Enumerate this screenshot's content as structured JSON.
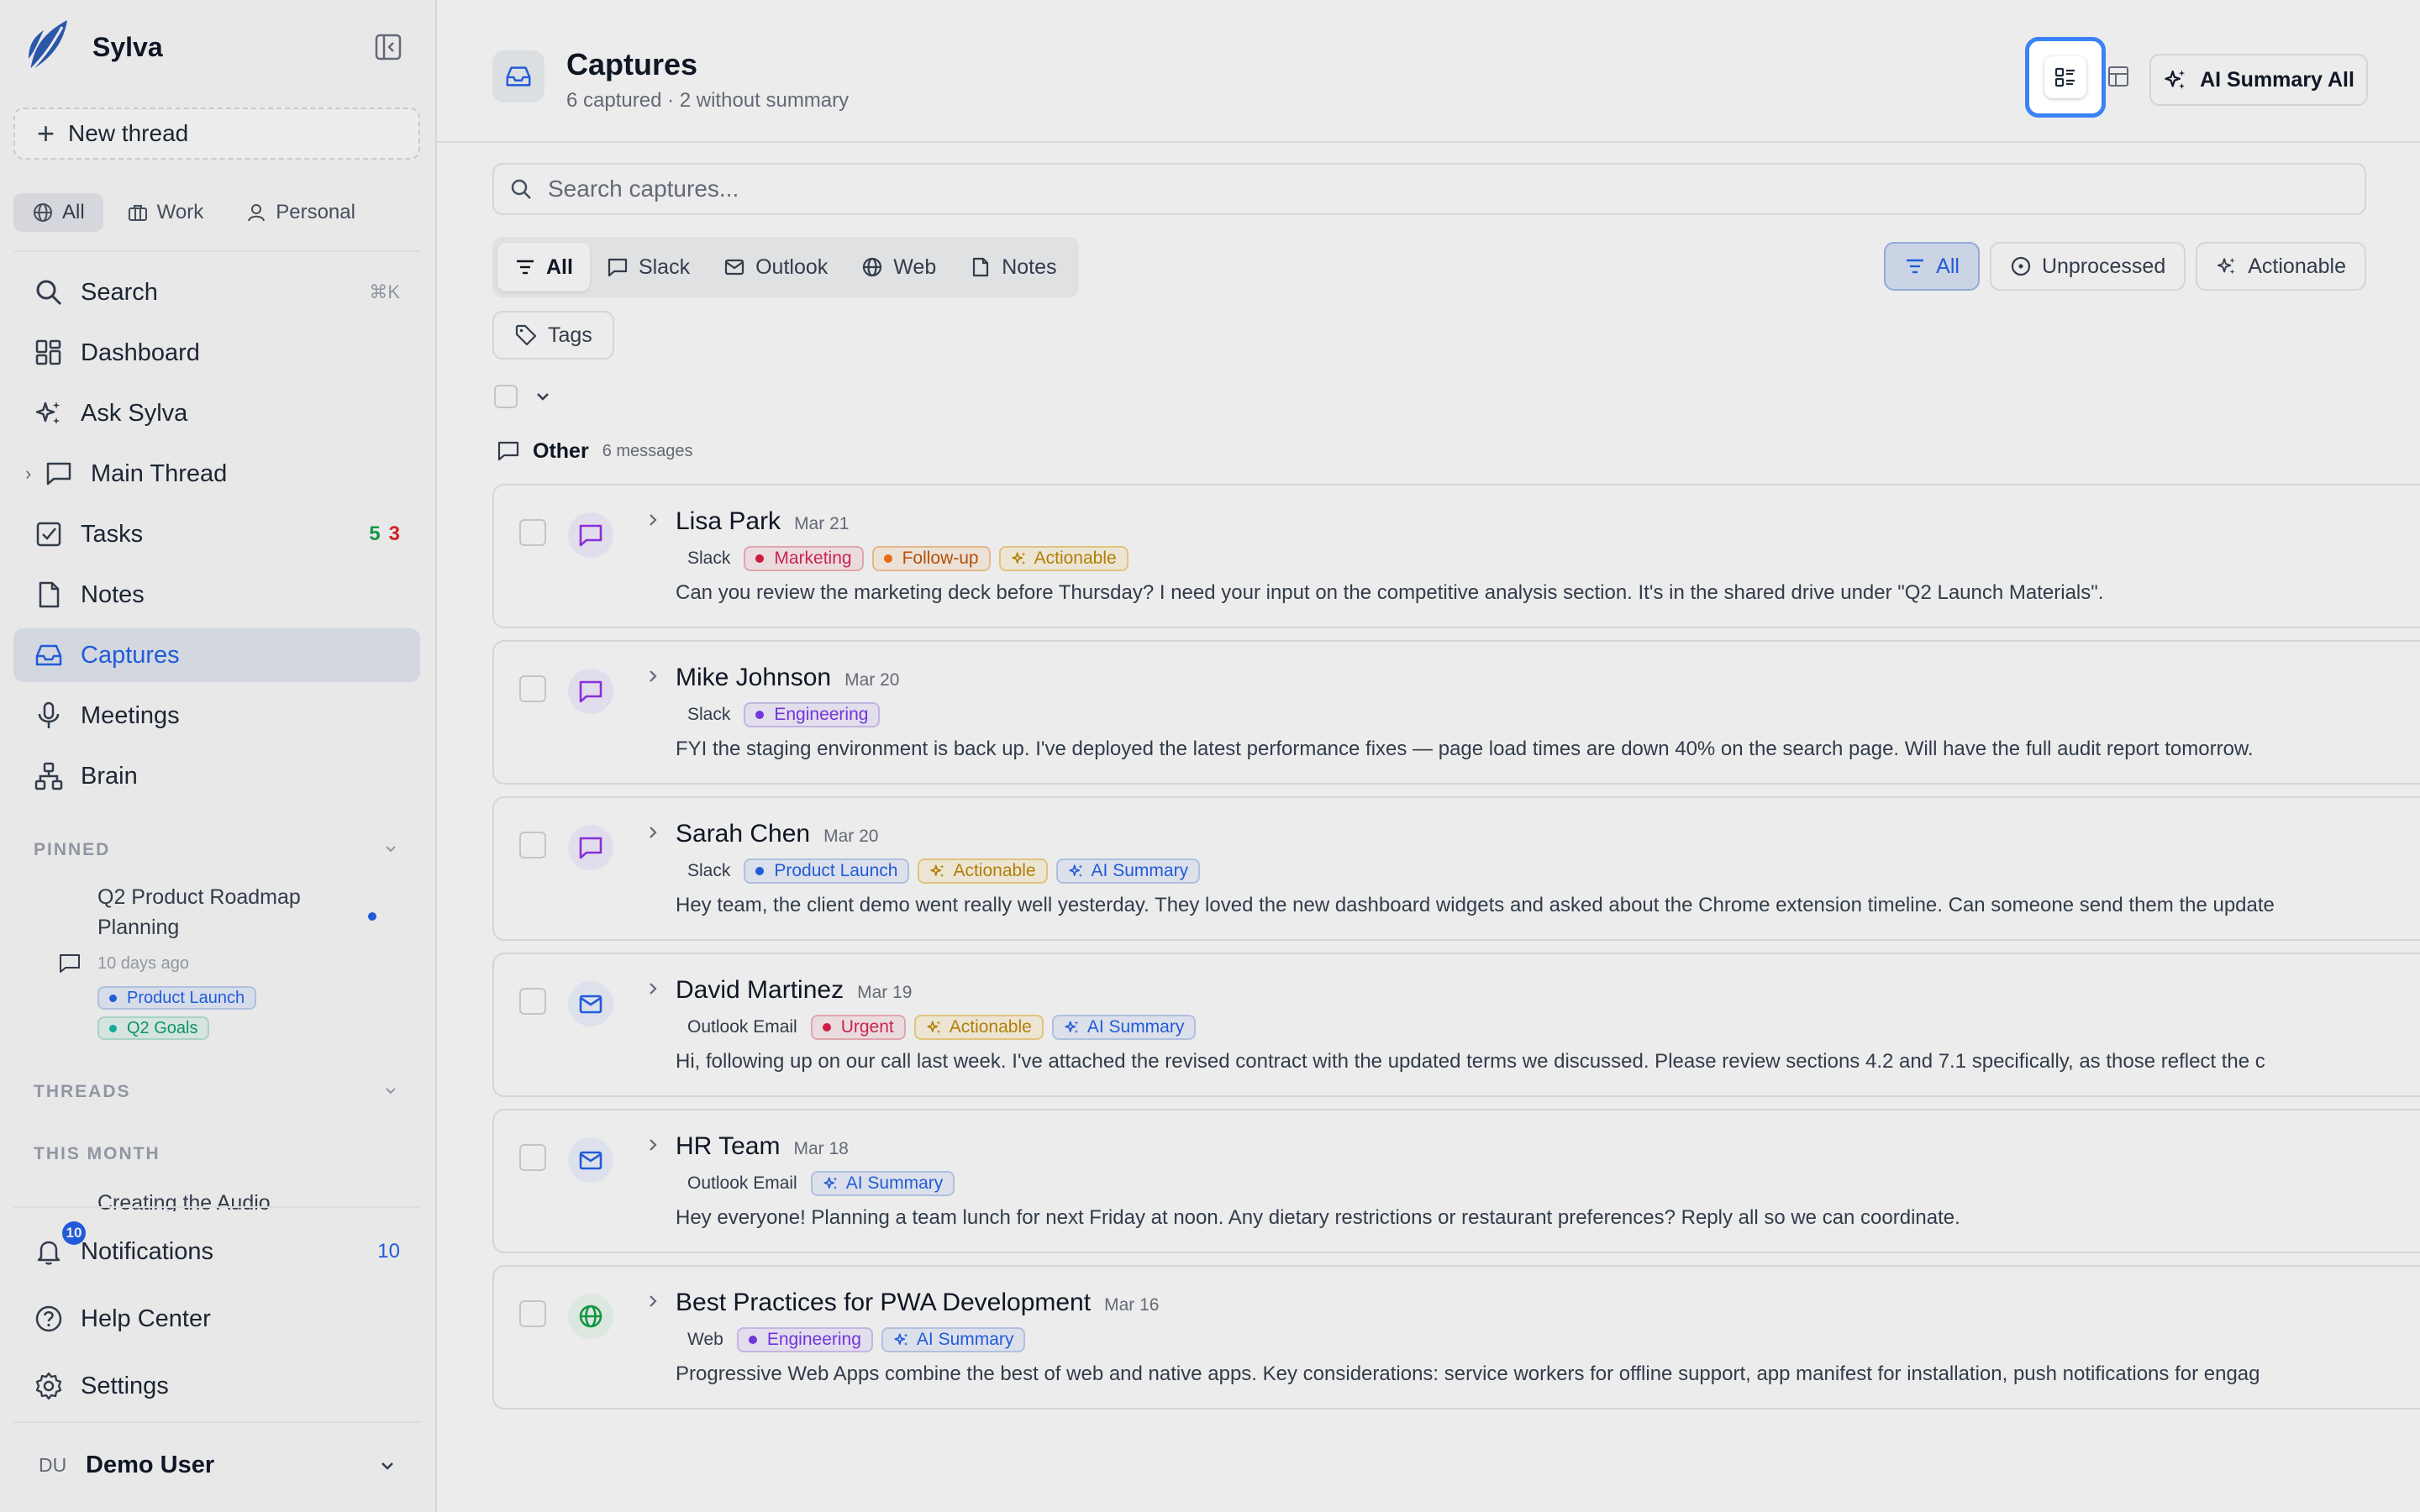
{
  "app": {
    "name": "Sylva"
  },
  "sidebar": {
    "new_thread": "New thread",
    "scope": [
      {
        "label": "All",
        "icon": "globe-icon"
      },
      {
        "label": "Work",
        "icon": "briefcase-icon"
      },
      {
        "label": "Personal",
        "icon": "user-icon"
      }
    ],
    "nav": [
      {
        "label": "Search",
        "icon": "search-icon",
        "shortcut": "⌘K"
      },
      {
        "label": "Dashboard",
        "icon": "dashboard-icon"
      },
      {
        "label": "Ask Sylva",
        "icon": "sparkles-icon"
      },
      {
        "label": "Main Thread",
        "icon": "chat-icon"
      },
      {
        "label": "Tasks",
        "icon": "checkbox-icon",
        "count_done": "5",
        "count_open": "3"
      },
      {
        "label": "Notes",
        "icon": "note-icon"
      },
      {
        "label": "Captures",
        "icon": "inbox-icon"
      },
      {
        "label": "Meetings",
        "icon": "microphone-icon"
      },
      {
        "label": "Brain",
        "icon": "network-icon"
      }
    ],
    "pinned": {
      "title": "PINNED",
      "item": {
        "title": "Q2 Product Roadmap Planning",
        "time": "10 days ago",
        "tags": [
          "Product Launch",
          "Q2 Goals"
        ]
      }
    },
    "threads_title": "THREADS",
    "month_title": "THIS MONTH",
    "month_item": "Creating the Audio",
    "notifications": {
      "label": "Notifications",
      "count": "10",
      "badge": "10"
    },
    "help": "Help Center",
    "settings": "Settings",
    "user": {
      "initials": "DU",
      "name": "Demo User"
    }
  },
  "header": {
    "title": "Captures",
    "subtitle": "6 captured · 2 without summary",
    "ai_all": "AI Summary All"
  },
  "search": {
    "placeholder": "Search captures..."
  },
  "source_filters": [
    {
      "label": "All",
      "icon": "filter-icon"
    },
    {
      "label": "Slack",
      "icon": "chat-icon"
    },
    {
      "label": "Outlook",
      "icon": "mail-icon"
    },
    {
      "label": "Web",
      "icon": "globe-icon"
    },
    {
      "label": "Notes",
      "icon": "note-icon"
    }
  ],
  "state_filters": [
    {
      "label": "All",
      "icon": "filter-icon"
    },
    {
      "label": "Unprocessed",
      "icon": "circle-icon"
    },
    {
      "label": "Actionable",
      "icon": "sparkles-icon"
    }
  ],
  "tags_button": "Tags",
  "group": {
    "name": "Other",
    "count": "6 messages"
  },
  "colors": {
    "accent": "#2563eb",
    "slack": "#9333ea",
    "outlook": "#2563eb",
    "web": "#16a34a"
  },
  "captures": [
    {
      "name": "Lisa Park",
      "date": "Mar 21",
      "source": "Slack",
      "type": "slack",
      "tags": [
        {
          "label": "Marketing",
          "kind": "red"
        },
        {
          "label": "Follow-up",
          "kind": "orange"
        },
        {
          "label": "Actionable",
          "kind": "actionable"
        }
      ],
      "message": "Can you review the marketing deck before Thursday? I need your input on the competitive analysis section. It's in the shared drive under \"Q2 Launch Materials\"."
    },
    {
      "name": "Mike Johnson",
      "date": "Mar 20",
      "source": "Slack",
      "type": "slack",
      "tags": [
        {
          "label": "Engineering",
          "kind": "purple"
        }
      ],
      "message": "FYI the staging environment is back up. I've deployed the latest performance fixes — page load times are down 40% on the search page. Will have the full audit report tomorrow."
    },
    {
      "name": "Sarah Chen",
      "date": "Mar 20",
      "source": "Slack",
      "type": "slack",
      "tags": [
        {
          "label": "Product Launch",
          "kind": "blue"
        },
        {
          "label": "Actionable",
          "kind": "actionable"
        },
        {
          "label": "AI Summary",
          "kind": "ai"
        }
      ],
      "message": "Hey team, the client demo went really well yesterday. They loved the new dashboard widgets and asked about the Chrome extension timeline. Can someone send them the update"
    },
    {
      "name": "David Martinez",
      "date": "Mar 19",
      "source": "Outlook Email",
      "type": "outlook",
      "tags": [
        {
          "label": "Urgent",
          "kind": "red"
        },
        {
          "label": "Actionable",
          "kind": "actionable"
        },
        {
          "label": "AI Summary",
          "kind": "ai"
        }
      ],
      "message": "Hi, following up on our call last week. I've attached the revised contract with the updated terms we discussed. Please review sections 4.2 and 7.1 specifically, as those reflect the c"
    },
    {
      "name": "HR Team",
      "date": "Mar 18",
      "source": "Outlook Email",
      "type": "outlook",
      "tags": [
        {
          "label": "AI Summary",
          "kind": "ai"
        }
      ],
      "message": "Hey everyone! Planning a team lunch for next Friday at noon. Any dietary restrictions or restaurant preferences? Reply all so we can coordinate."
    },
    {
      "name": "Best Practices for PWA Development",
      "date": "Mar 16",
      "source": "Web",
      "type": "web",
      "tags": [
        {
          "label": "Engineering",
          "kind": "purple"
        },
        {
          "label": "AI Summary",
          "kind": "ai"
        }
      ],
      "message": "Progressive Web Apps combine the best of web and native apps. Key considerations: service workers for offline support, app manifest for installation, push notifications for engag"
    }
  ]
}
